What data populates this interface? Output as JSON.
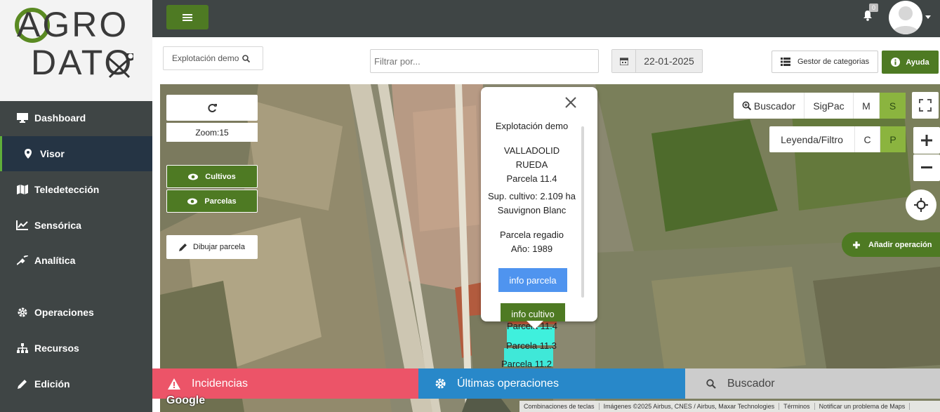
{
  "app": {
    "logo_line1": "AGRO",
    "logo_line2": "DATO"
  },
  "sidebar": {
    "items": [
      {
        "label": "Dashboard",
        "icon": "monitor-icon",
        "active": false
      },
      {
        "label": "Visor",
        "icon": "map-marker-icon",
        "active": true
      },
      {
        "label": "Teledetección",
        "icon": "map-icon",
        "active": false
      },
      {
        "label": "Sensórica",
        "icon": "line-chart-icon",
        "active": false
      },
      {
        "label": "Analítica",
        "icon": "satellite-icon",
        "active": false
      },
      {
        "label": "Operaciones",
        "icon": "gear-icon",
        "active": false
      },
      {
        "label": "Recursos",
        "icon": "sitemap-icon",
        "active": false
      },
      {
        "label": "Edición",
        "icon": "pencil-icon",
        "active": false
      }
    ]
  },
  "topbar": {
    "notification_count": "0"
  },
  "filters": {
    "explotacion": "Explotación demo",
    "filter_placeholder": "Filtrar por...",
    "date": "22-01-2025",
    "gestor_label": "Gestor de categorias",
    "ayuda_label": "Ayuda"
  },
  "map_controls": {
    "zoom_label": "Zoom:15",
    "cultivos_label": "Cultivos",
    "parcelas_label": "Parcelas",
    "dibujar_label": "Dibujar parcela",
    "buscador_label": "Buscador",
    "sigpac_label": "SigPac",
    "m_label": "M",
    "s_label": "S",
    "leyenda_label": "Leyenda/Filtro",
    "c_label": "C",
    "p_label": "P",
    "anadir_label": "Añadir operación"
  },
  "popup": {
    "explotacion": "Explotación demo",
    "provincia": "VALLADOLID",
    "municipio": "RUEDA",
    "parcela": "Parcela 11.4",
    "superficie": "Sup. cultivo: 2.109 ha",
    "variedad": "Sauvignon Blanc",
    "tipo": "Parcela regadio",
    "anio": "Año: 1989",
    "info_parcela": "info parcela",
    "info_cultivo": "info cultivo"
  },
  "parcel_labels": [
    "Parcela 11.4",
    "Parcela 11.3",
    "Parcela 11.2"
  ],
  "bottom_tabs": {
    "incidencias": "Incidencias",
    "operaciones": "Últimas operaciones",
    "buscador": "Buscador"
  },
  "map_footer": {
    "google": "Google",
    "attributions": [
      "Combinaciones de teclas",
      "Imágenes ©2025 Airbus, CNES / Airbus, Maxar Technologies",
      "Términos",
      "Notificar un problema de Maps"
    ]
  },
  "colors": {
    "brand_green": "#4e7a23",
    "incidencias": "#ec5468",
    "operaciones": "#2888c9",
    "buscador": "#cccccc",
    "parcel_highlight": "#d9683a",
    "parcel_cyan": "#2de0d0"
  }
}
